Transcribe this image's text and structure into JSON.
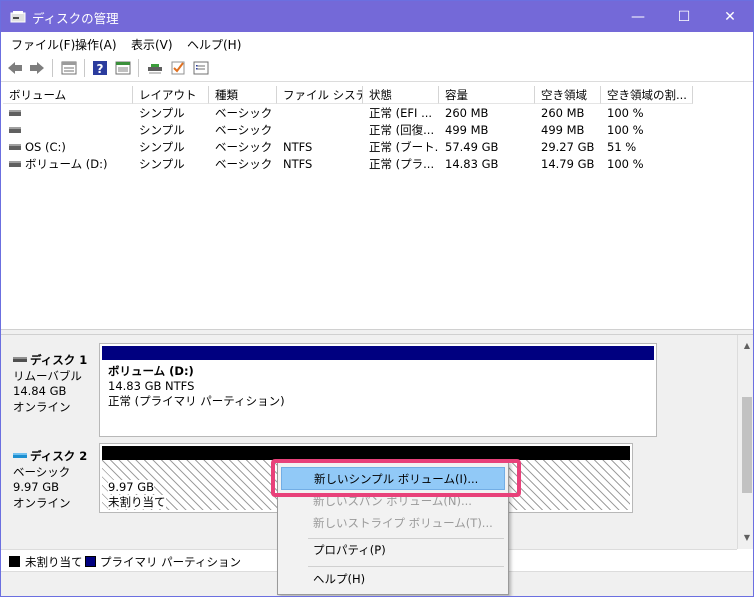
{
  "window": {
    "title": "ディスクの管理",
    "minimize_glyph": "—",
    "maximize_glyph": "☐",
    "close_glyph": "✕"
  },
  "menu": {
    "items": [
      {
        "label": "ファイル(F)"
      },
      {
        "label": "操作(A)"
      },
      {
        "label": "表示(V)"
      },
      {
        "label": "ヘルプ(H)"
      }
    ]
  },
  "toolbar": {
    "icons": [
      "back-icon",
      "forward-icon",
      "list-view-icon",
      "help-icon",
      "properties-icon",
      "connect-icon",
      "check-icon",
      "settings-list-icon"
    ]
  },
  "volume_table": {
    "columns": [
      "ボリューム",
      "レイアウト",
      "種類",
      "ファイル システム",
      "状態",
      "容量",
      "空き領域",
      "空き領域の割..."
    ],
    "rows": [
      {
        "volume": "",
        "layout": "シンプル",
        "type": "ベーシック",
        "fs": "",
        "status": "正常 (EFI ...",
        "capacity": "260 MB",
        "free": "260 MB",
        "pct": "100 %"
      },
      {
        "volume": "",
        "layout": "シンプル",
        "type": "ベーシック",
        "fs": "",
        "status": "正常 (回復...",
        "capacity": "499 MB",
        "free": "499 MB",
        "pct": "100 %"
      },
      {
        "volume": "OS (C:)",
        "layout": "シンプル",
        "type": "ベーシック",
        "fs": "NTFS",
        "status": "正常 (ブート...",
        "capacity": "57.49 GB",
        "free": "29.27 GB",
        "pct": "51 %"
      },
      {
        "volume": "ボリューム (D:)",
        "layout": "シンプル",
        "type": "ベーシック",
        "fs": "NTFS",
        "status": "正常 (プラ...",
        "capacity": "14.83 GB",
        "free": "14.79 GB",
        "pct": "100 %"
      }
    ]
  },
  "disks": [
    {
      "name": "ディスク 1",
      "type": "リムーバブル",
      "size": "14.84 GB",
      "state": "オンライン",
      "partition": {
        "title": "ボリューム  (D:)",
        "line2": "14.83 GB NTFS",
        "line3": "正常 (プライマリ パーティション)"
      }
    },
    {
      "name": "ディスク 2",
      "type": "ベーシック",
      "size": "9.97 GB",
      "state": "オンライン",
      "partition": {
        "line2": "9.97 GB",
        "line3": "未割り当て"
      }
    }
  ],
  "legend": {
    "unallocated": "未割り当て",
    "primary": "プライマリ パーティション"
  },
  "context_menu": {
    "items": [
      {
        "label": "新しいシンプル ボリューム(I)...",
        "enabled": true,
        "highlighted": true
      },
      {
        "label": "新しいスパン ボリューム(N)...",
        "enabled": false
      },
      {
        "label": "新しいストライプ ボリューム(T)...",
        "enabled": false
      },
      {
        "label": "プロパティ(P)",
        "enabled": true
      },
      {
        "label": "ヘルプ(H)",
        "enabled": true
      }
    ]
  },
  "colors": {
    "titlebar": "#7469d8",
    "primary_partition": "#000080",
    "unallocated": "#000000",
    "highlight_box": "#e8417a",
    "menu_hover": "#91c9f7"
  }
}
